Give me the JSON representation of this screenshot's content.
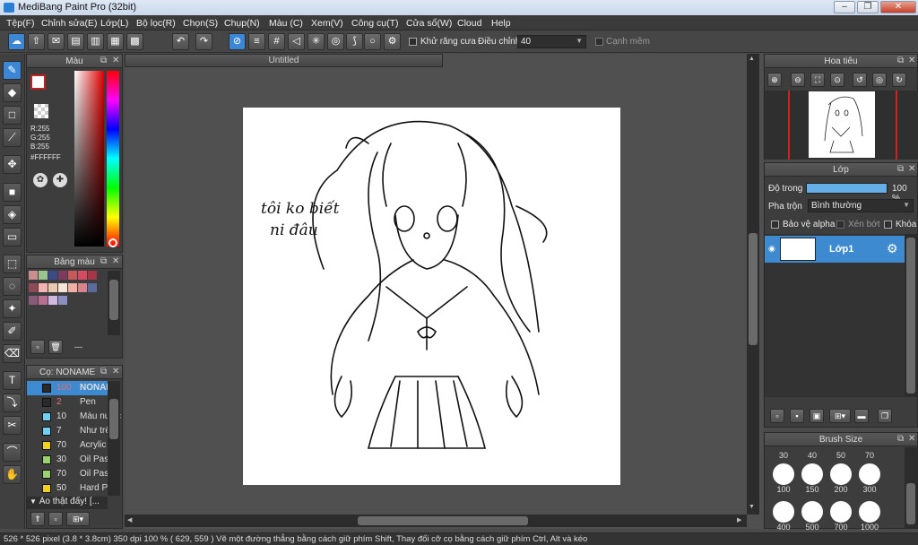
{
  "window": {
    "title": "MediBang Paint Pro (32bit)"
  },
  "menu": [
    "Tệp(F)",
    "Chỉnh sửa(E)",
    "Lớp(L)",
    "Bộ lọc(R)",
    "Chọn(S)",
    "Chụp(N)",
    "Màu (C)",
    "Xem(V)",
    "Công cụ(T)",
    "Cửa sổ(W)",
    "Cloud",
    "Help"
  ],
  "toolbar": {
    "antialias_label": "Khử răng cưa",
    "adjust_label": "Điều chỉnh",
    "adjust_value": "40",
    "soft_edge_label": "Cạnh mềm"
  },
  "color_panel": {
    "title": "Màu",
    "r": "R:255",
    "g": "G:255",
    "b": "B:255",
    "hex": "#FFFFFF"
  },
  "palette_panel": {
    "title": "Bảng màu",
    "extra": "---",
    "swatches": [
      "#c98e8e",
      "#9ac58d",
      "#3c4a8a",
      "#7f3a5f",
      "#c65a5a",
      "#d64a62",
      "#a63548",
      "#8b4a56",
      "#f4b3b3",
      "#e9c9b0",
      "#f5e6d6",
      "#f0b0a6",
      "#d9848a",
      "#5a6a9a",
      "#8a5a7a",
      "#b97090",
      "#d0b8e0",
      "#8a90c0"
    ]
  },
  "brush_panel": {
    "title": "Cọ: NONAME",
    "items": [
      {
        "size": "100",
        "name": "NONAME",
        "color": "#2a2a2a",
        "selected": true
      },
      {
        "size": "2",
        "name": "Pen",
        "color": "#2a2a2a",
        "selected": false
      },
      {
        "size": "10",
        "name": "Màu nước",
        "color": "#6fd0f0",
        "selected": false
      },
      {
        "size": "7",
        "name": "Như trên",
        "color": "#6fd0f0",
        "selected": false
      },
      {
        "size": "70",
        "name": "Acrylic",
        "color": "#f0d020",
        "selected": false
      },
      {
        "size": "30",
        "name": "Oil Paste",
        "color": "#9ad070",
        "selected": false
      },
      {
        "size": "70",
        "name": "Oil Paste",
        "color": "#9ad070",
        "selected": false
      },
      {
        "size": "50",
        "name": "Hard Pen",
        "color": "#f0d020",
        "selected": false
      }
    ],
    "group_label": "Ảo thật đấy! [..."
  },
  "canvas": {
    "tab_title": "Untitled",
    "handwriting_line1": "tôi ko biết",
    "handwriting_line2": "ni đâu"
  },
  "navigator": {
    "title": "Hoa tiêu"
  },
  "layer_panel": {
    "title": "Lớp",
    "opacity_label": "Độ trong",
    "opacity_value": "100 %",
    "opacity": 1.0,
    "blend_label": "Pha trộn",
    "blend_value": "Bình thường",
    "protect_alpha": "Bảo vệ alpha",
    "clipping": "Xén bớt",
    "lock": "Khóa",
    "layer_name": "Lớp1"
  },
  "brush_size": {
    "title": "Brush Size",
    "row1": [
      "30",
      "40",
      "50",
      "70"
    ],
    "row2": [
      "100",
      "150",
      "200",
      "300"
    ],
    "row3": [
      "400",
      "500",
      "700",
      "1000"
    ]
  },
  "status": {
    "text": "526 * 526 pixel   (3.8 * 3.8cm)   350 dpi   100 %   ( 629, 559 )   Vẽ một đường thẳng bằng cách giữ phím Shift, Thay đổi cỡ cọ bằng cách giữ phím Ctrl, Alt và kéo"
  },
  "colors": {
    "accent": "#3b87d6",
    "panel": "#3d3d3d",
    "canvas_bg": "#505050"
  }
}
